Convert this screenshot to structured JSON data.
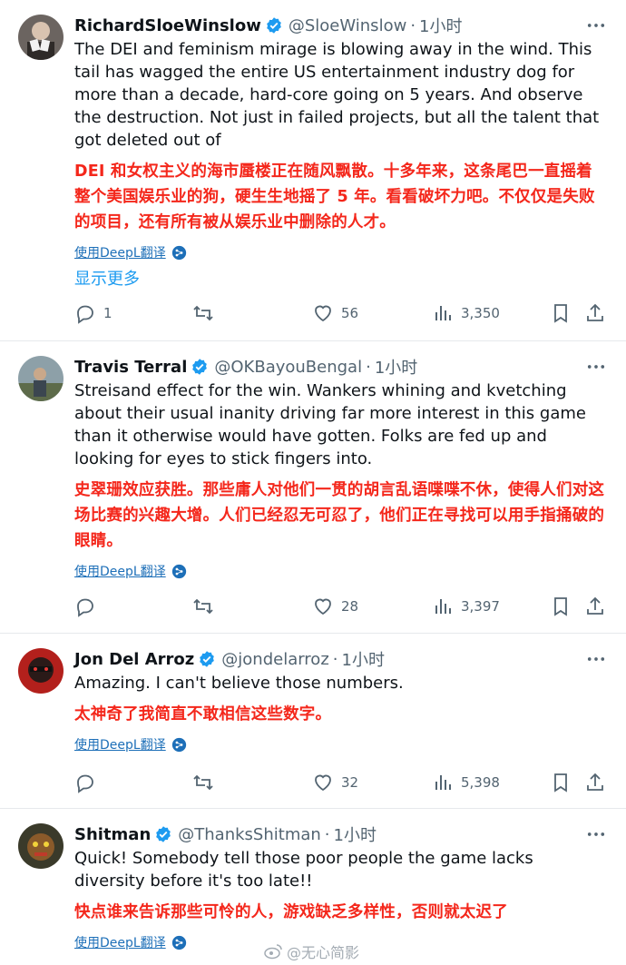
{
  "tweets": [
    {
      "name": "RichardSloeWinslow",
      "handle": "@SloeWinslow",
      "time": "1小时",
      "text": "The DEI and feminism mirage is blowing away in the wind.   This tail has wagged the entire US entertainment industry dog for more than a decade, hard-core going on 5 years.  And observe the destruction.  Not just in failed projects, but all the talent that got deleted out of",
      "translation": "DEI 和女权主义的海市蜃楼正在随风飘散。十多年来，这条尾巴一直摇着整个美国娱乐业的狗，硬生生地摇了 5 年。看看破坏力吧。不仅仅是失败的项目，还有所有被从娱乐业中删除的人才。",
      "translate_label": "使用DeepL翻译",
      "show_more": "显示更多",
      "replies": "1",
      "retweets": "",
      "likes": "56",
      "views": "3,350"
    },
    {
      "name": "Travis Terral",
      "handle": "@OKBayouBengal",
      "time": "1小时",
      "text": "Streisand effect for the win.  Wankers whining and kvetching about their usual inanity driving far more interest in this game than it otherwise would have gotten.  Folks are fed up and looking for eyes to stick fingers into.",
      "translation": "史翠珊效应获胜。那些庸人对他们一贯的胡言乱语喋喋不休，使得人们对这场比赛的兴趣大增。人们已经忍无可忍了，他们正在寻找可以用手指捅破的眼睛。",
      "translate_label": "使用DeepL翻译",
      "replies": "",
      "retweets": "",
      "likes": "28",
      "views": "3,397"
    },
    {
      "name": "Jon Del Arroz",
      "handle": "@jondelarroz",
      "time": "1小时",
      "text": "Amazing. I can't believe those numbers.",
      "translation": "太神奇了我简直不敢相信这些数字。",
      "translate_label": "使用DeepL翻译",
      "replies": "",
      "retweets": "",
      "likes": "32",
      "views": "5,398"
    },
    {
      "name": "Shitman",
      "handle": "@ThanksShitman",
      "time": "1小时",
      "text": "Quick! Somebody tell those poor people the game lacks diversity before it's too late!!",
      "translation": "快点谁来告诉那些可怜的人，游戏缺乏多样性，否则就太迟了",
      "translate_label": "使用DeepL翻译"
    }
  ],
  "separator": "·",
  "watermark": "@无心简影",
  "colors": {
    "verified": "#1d9bf0",
    "translation_text": "#f4271b",
    "link": "#1d9bf0",
    "muted": "#536471"
  }
}
